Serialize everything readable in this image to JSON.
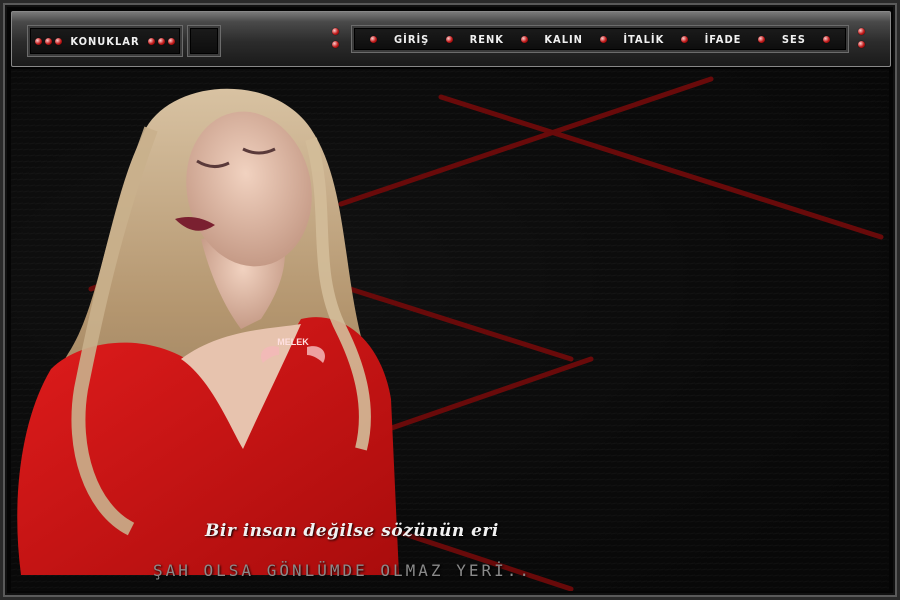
{
  "topbar": {
    "left_button": "KONUKLAR",
    "nav": [
      "GİRİŞ",
      "RENK",
      "KALIN",
      "İTALİK",
      "İFADE",
      "SES"
    ]
  },
  "badge": {
    "text": "MELEK"
  },
  "quotes": {
    "line1": "Bir insan değilse sözünün eri",
    "line2": "ŞAH OLSA GÖNLÜMDE OLMAZ YERİ.."
  },
  "colors": {
    "accent": "#c01818",
    "stripe": "#6e0a0a",
    "sweater": "#d41414"
  }
}
